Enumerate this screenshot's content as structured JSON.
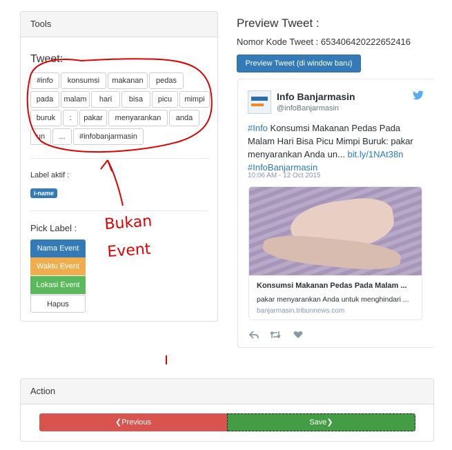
{
  "tools": {
    "heading": "Tools",
    "tweet_label": "Tweet:",
    "tokens": [
      "#info",
      "konsumsi",
      "makanan",
      "pedas",
      "pada",
      "malam",
      "hari",
      "bisa",
      "picu",
      "mimpi",
      "buruk",
      ":",
      "pakar",
      "menyarankan",
      "anda",
      "un",
      "...",
      "#infobanjarmasin"
    ],
    "active_label_title": "Label aktif :",
    "active_label_badge": "i-name",
    "pick_label_title": "Pick Label :",
    "pick_buttons": {
      "nama": "Nama Event",
      "waktu": "Waktu Event",
      "lokasi": "Lokasi Event",
      "hapus": "Hapus"
    }
  },
  "annotation": {
    "line1": "Bukan",
    "line2": "Event",
    "color": "#e00000"
  },
  "preview": {
    "title": "Preview Tweet :",
    "kode_label": "Nomor Kode Tweet : 653406420222652416",
    "button": "Preview Tweet (di window baru)",
    "tweet": {
      "account_name": "Info Banjarmasin",
      "handle": "@infoBanjarmasin",
      "hashtag1": "#Info",
      "body": " Konsumsi Makanan Pedas Pada Malam Hari Bisa Picu Mimpi Buruk: pakar menyarankan Anda un... ",
      "link": "bit.ly/1NAt38n",
      "hashtag2": "#InfoBanjarmasin",
      "time": "10:06 AM - 12 Oct 2015",
      "card_title": "Konsumsi Makanan Pedas Pada Malam ...",
      "card_desc": "pakar menyarankan Anda untuk menghindari ...",
      "card_domain": "banjarmasin.tribunnews.com"
    }
  },
  "action": {
    "heading": "Action",
    "previous": "Previous",
    "save": "Save"
  },
  "colors": {
    "primary": "#337ab7",
    "warning": "#f0ad4e",
    "success": "#5cb85c",
    "danger": "#d9534f",
    "link": "#2b7bb9"
  }
}
